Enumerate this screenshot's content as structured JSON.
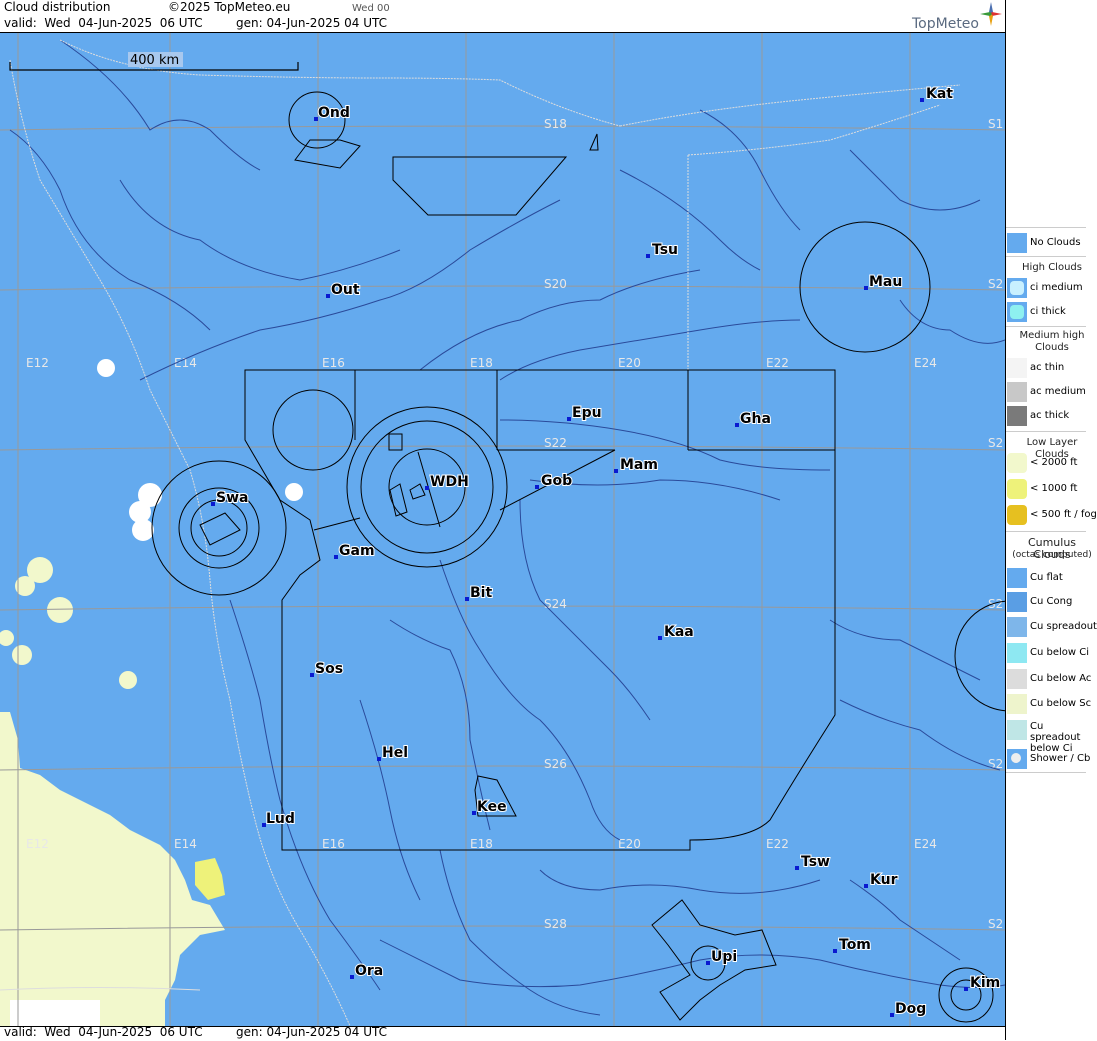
{
  "header": {
    "title": "Cloud distribution",
    "copyright": "©2025 TopMeteo.eu",
    "run": "Wed 00",
    "valid": "valid:  Wed  04-Jun-2025  06 UTC",
    "gen": "gen: 04-Jun-2025 04 UTC",
    "logo": "TopMeteo"
  },
  "footer": {
    "valid": "valid:  Wed  04-Jun-2025  06 UTC",
    "gen": "gen: 04-Jun-2025 04 UTC"
  },
  "map": {
    "scale_label": "400 km",
    "grid_labels": [
      "E12",
      "E14",
      "E16",
      "E18",
      "E20",
      "E22",
      "E24",
      "E12",
      "E14",
      "E16",
      "E18",
      "E20",
      "E22",
      "E24",
      "S18",
      "S20",
      "S22",
      "S24",
      "S26",
      "S28",
      "S1",
      "S2",
      "S2",
      "S2",
      "S2",
      "S2"
    ],
    "cities": [
      {
        "name": "Ond"
      },
      {
        "name": "Kat"
      },
      {
        "name": "Tsu"
      },
      {
        "name": "Mau"
      },
      {
        "name": "Out"
      },
      {
        "name": "Epu"
      },
      {
        "name": "Gha"
      },
      {
        "name": "Mam"
      },
      {
        "name": "Swa"
      },
      {
        "name": "WDH"
      },
      {
        "name": "Gob"
      },
      {
        "name": "Gam"
      },
      {
        "name": "Bit"
      },
      {
        "name": "Kaa"
      },
      {
        "name": "Sos"
      },
      {
        "name": "Hel"
      },
      {
        "name": "Kee"
      },
      {
        "name": "Lud"
      },
      {
        "name": "Tsw"
      },
      {
        "name": "Kur"
      },
      {
        "name": "Tom"
      },
      {
        "name": "Ora"
      },
      {
        "name": "Upi"
      },
      {
        "name": "Kim"
      },
      {
        "name": "Dog"
      }
    ]
  },
  "legend": {
    "no_clouds": "No Clouds",
    "high_head": "High Clouds",
    "ci_medium": "ci medium",
    "ci_thick": "ci thick",
    "medium_head": "Medium high Clouds",
    "ac_thin": "ac thin",
    "ac_medium": "ac medium",
    "ac_thick": "ac thick",
    "low_head": "Low Layer Clouds",
    "low_2000": "< 2000 ft",
    "low_1000": "< 1000 ft",
    "low_500": "< 500 ft / fog",
    "cu_head": "Cumulus Clouds",
    "cu_sub": "(octas computed)",
    "cu_flat": "Cu flat",
    "cu_cong": "Cu Cong",
    "cu_spread": "Cu spreadout",
    "cu_below_ci": "Cu below Ci",
    "cu_below_ac": "Cu below Ac",
    "cu_below_sc": "Cu below Sc",
    "cu_spread_ci": "Cu spreadout below Ci",
    "shower": "Shower / Cb"
  },
  "colors": {
    "sea_land": "#64aaee",
    "low_cloud": "#f2f8cc",
    "low_cloud_1000": "#eef27a",
    "fog": "#e6c020",
    "cu_white": "#ffffff"
  }
}
